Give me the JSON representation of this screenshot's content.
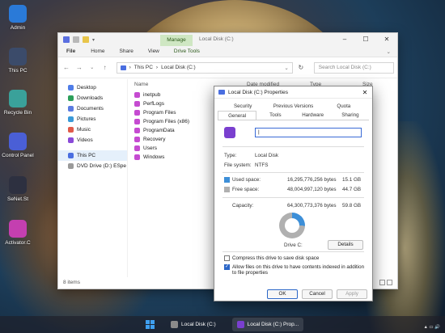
{
  "desktop": {
    "icons": [
      {
        "label": "Admin",
        "color": "#2a7ad8"
      },
      {
        "label": "This PC",
        "color": "#3b4b6a"
      },
      {
        "label": "Recycle Bin",
        "color": "#3aa19a"
      },
      {
        "label": "Control Panel",
        "color": "#4a5fd6"
      },
      {
        "label": "SeNet.St",
        "color": "#2d3040"
      },
      {
        "label": "Activator.C",
        "color": "#c43fb0"
      }
    ]
  },
  "explorer": {
    "manage_tab": "Manage",
    "title": "Local Disk (C:)",
    "ribbon": {
      "file": "File",
      "home": "Home",
      "share": "Share",
      "view": "View",
      "drive_tools": "Drive Tools"
    },
    "address": {
      "root": "This PC",
      "sep": "›",
      "current": "Local Disk (C:)"
    },
    "search_placeholder": "Search Local Disk (C:)",
    "nav": [
      {
        "label": "Desktop",
        "color": "#4f7de8"
      },
      {
        "label": "Downloads",
        "color": "#2c9f5a"
      },
      {
        "label": "Documents",
        "color": "#5a7be0"
      },
      {
        "label": "Pictures",
        "color": "#3a9ad8"
      },
      {
        "label": "Music",
        "color": "#e05a4a"
      },
      {
        "label": "Videos",
        "color": "#8a4ad8"
      }
    ],
    "nav_this_pc": "This PC",
    "nav_dvd": "DVD Drive (D:) ESpe",
    "columns": {
      "name": "Name",
      "date": "Date modified",
      "type": "Type",
      "size": "Size"
    },
    "files": [
      "inetpub",
      "PerfLogs",
      "Program Files",
      "Program Files (x86)",
      "ProgramData",
      "Recovery",
      "Users",
      "Windows"
    ],
    "status": "8 items"
  },
  "dialog": {
    "title": "Local Disk (C:) Properties",
    "tabs_top": [
      "Security",
      "Previous Versions",
      "Quota"
    ],
    "tabs_bottom": [
      "General",
      "Tools",
      "Hardware",
      "Sharing"
    ],
    "type_label": "Type:",
    "type_value": "Local Disk",
    "fs_label": "File system:",
    "fs_value": "NTFS",
    "used_label": "Used space:",
    "used_bytes": "16,295,776,256 bytes",
    "used_gb": "15.1 GB",
    "free_label": "Free space:",
    "free_bytes": "48,004,997,120 bytes",
    "free_gb": "44.7 GB",
    "cap_label": "Capacity:",
    "cap_bytes": "64,300,773,376 bytes",
    "cap_gb": "59.8 GB",
    "used_fraction": 0.253,
    "drive_label": "Drive C:",
    "details_btn": "Details",
    "compress_label": "Compress this drive to save disk space",
    "index_label": "Allow files on this drive to have contents indexed in addition to file properties",
    "ok": "OK",
    "cancel": "Cancel",
    "apply": "Apply",
    "colors": {
      "used": "#3d8fd8",
      "free": "#b0b0b0"
    }
  },
  "taskbar": {
    "apps": [
      {
        "label": "Local Disk (C:)"
      },
      {
        "label": "Local Disk (C:) Prop..."
      }
    ]
  }
}
